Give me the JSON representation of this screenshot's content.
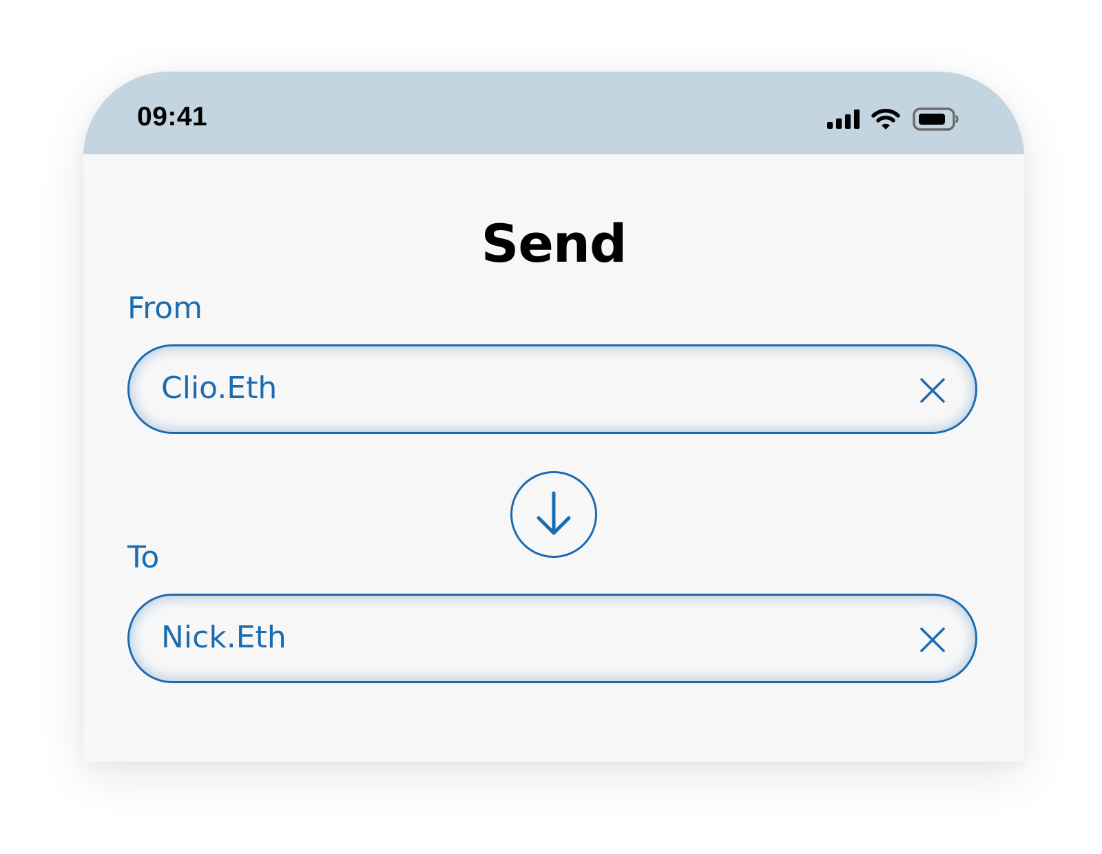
{
  "status_bar": {
    "time": "09:41",
    "icons": [
      "cellular-signal-icon",
      "wifi-icon",
      "battery-icon"
    ]
  },
  "screen": {
    "title": "Send",
    "from": {
      "label": "From",
      "value": "Clio.Eth",
      "clear_icon": "close-icon"
    },
    "swap_icon": "arrow-down-circle-icon",
    "to": {
      "label": "To",
      "value": "Nick.Eth",
      "clear_icon": "close-icon"
    }
  },
  "colors": {
    "accent": "#1b6bb0",
    "status_bar_bg": "#c4d5e2",
    "screen_bg": "#f7f7f7",
    "title_text": "#000000"
  }
}
